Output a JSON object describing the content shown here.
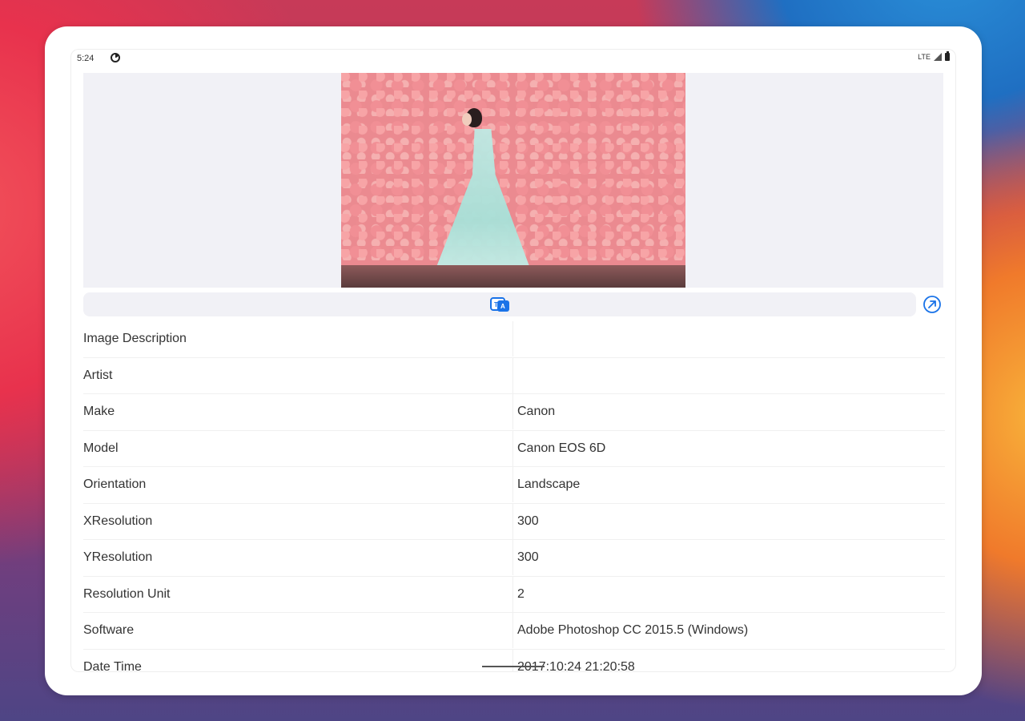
{
  "status_bar": {
    "time": "5:24",
    "network": "LTE"
  },
  "preview": {
    "description": "Photo preview"
  },
  "toolbar": {
    "translate_icon": "translate-icon",
    "share_icon": "share-icon"
  },
  "exif": {
    "rows": [
      {
        "key": "Image Description",
        "value": ""
      },
      {
        "key": "Artist",
        "value": ""
      },
      {
        "key": "Make",
        "value": "Canon"
      },
      {
        "key": "Model",
        "value": "Canon EOS 6D"
      },
      {
        "key": "Orientation",
        "value": "Landscape"
      },
      {
        "key": "XResolution",
        "value": "300"
      },
      {
        "key": "YResolution",
        "value": "300"
      },
      {
        "key": "Resolution Unit",
        "value": "2"
      },
      {
        "key": "Software",
        "value": "Adobe Photoshop CC 2015.5 (Windows)"
      },
      {
        "key": "Date Time",
        "value": "2017:10:24 21:20:58"
      }
    ]
  },
  "colors": {
    "accent": "#1a73e8",
    "row_divider": "#f0f0f0"
  }
}
